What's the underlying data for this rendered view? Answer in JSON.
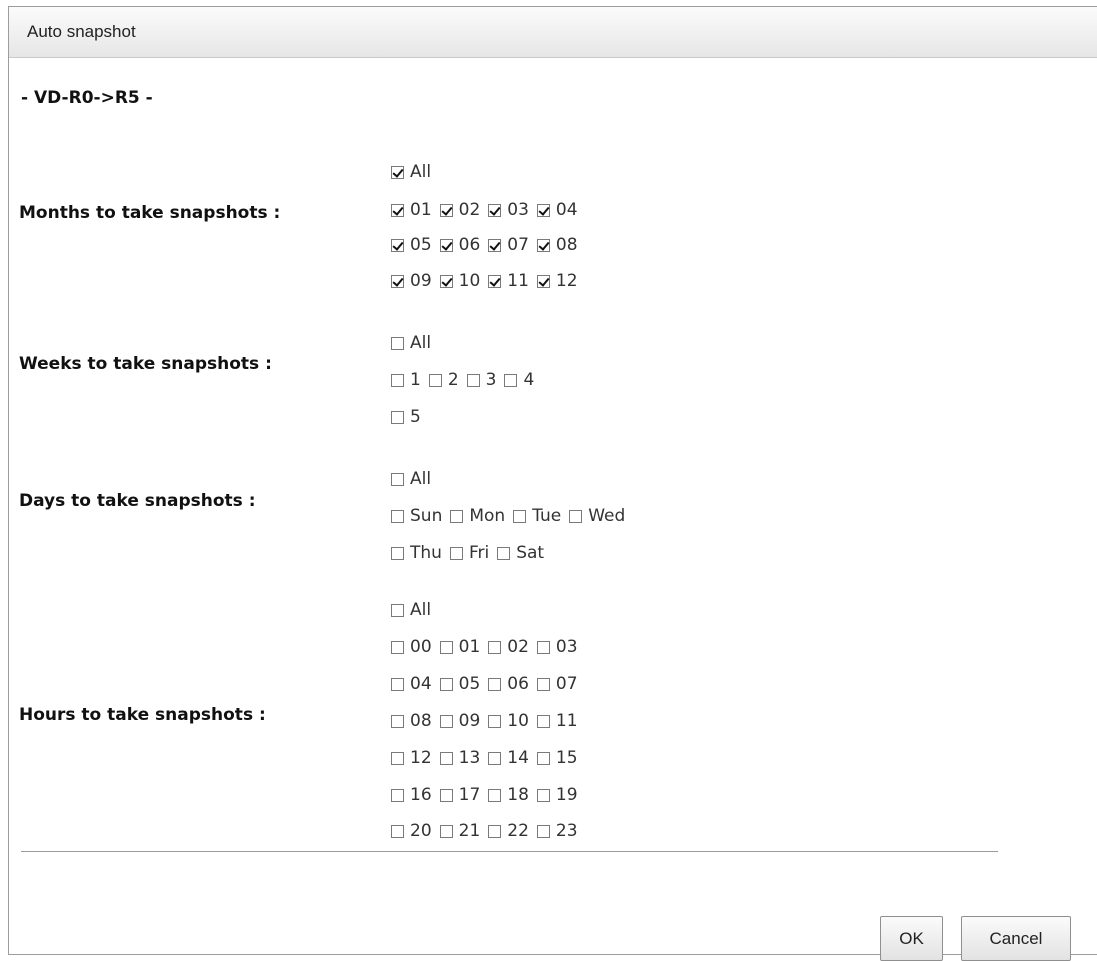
{
  "dialog": {
    "title": "Auto snapshot"
  },
  "vd_name": "- VD-R0->R5 -",
  "months": {
    "label": "Months to take snapshots :",
    "all": {
      "label": "All",
      "checked": true
    },
    "rows": [
      [
        {
          "label": "01",
          "checked": true
        },
        {
          "label": "02",
          "checked": true
        },
        {
          "label": "03",
          "checked": true
        },
        {
          "label": "04",
          "checked": true
        }
      ],
      [
        {
          "label": "05",
          "checked": true
        },
        {
          "label": "06",
          "checked": true
        },
        {
          "label": "07",
          "checked": true
        },
        {
          "label": "08",
          "checked": true
        }
      ],
      [
        {
          "label": "09",
          "checked": true
        },
        {
          "label": "10",
          "checked": true
        },
        {
          "label": "11",
          "checked": true
        },
        {
          "label": "12",
          "checked": true
        }
      ]
    ]
  },
  "weeks": {
    "label": "Weeks to take snapshots :",
    "all": {
      "label": "All",
      "checked": false
    },
    "rows": [
      [
        {
          "label": "1",
          "checked": false
        },
        {
          "label": "2",
          "checked": false
        },
        {
          "label": "3",
          "checked": false
        },
        {
          "label": "4",
          "checked": false
        }
      ],
      [
        {
          "label": "5",
          "checked": false
        }
      ]
    ]
  },
  "days": {
    "label": "Days to take snapshots :",
    "all": {
      "label": "All",
      "checked": false
    },
    "rows": [
      [
        {
          "label": "Sun",
          "checked": false
        },
        {
          "label": "Mon",
          "checked": false
        },
        {
          "label": "Tue",
          "checked": false
        },
        {
          "label": "Wed",
          "checked": false
        }
      ],
      [
        {
          "label": "Thu",
          "checked": false
        },
        {
          "label": "Fri",
          "checked": false
        },
        {
          "label": "Sat",
          "checked": false
        }
      ]
    ]
  },
  "hours": {
    "label": "Hours to take snapshots :",
    "all": {
      "label": "All",
      "checked": false
    },
    "rows": [
      [
        {
          "label": "00",
          "checked": false
        },
        {
          "label": "01",
          "checked": false
        },
        {
          "label": "02",
          "checked": false
        },
        {
          "label": "03",
          "checked": false
        }
      ],
      [
        {
          "label": "04",
          "checked": false
        },
        {
          "label": "05",
          "checked": false
        },
        {
          "label": "06",
          "checked": false
        },
        {
          "label": "07",
          "checked": false
        }
      ],
      [
        {
          "label": "08",
          "checked": false
        },
        {
          "label": "09",
          "checked": false
        },
        {
          "label": "10",
          "checked": false
        },
        {
          "label": "11",
          "checked": false
        }
      ],
      [
        {
          "label": "12",
          "checked": false
        },
        {
          "label": "13",
          "checked": false
        },
        {
          "label": "14",
          "checked": false
        },
        {
          "label": "15",
          "checked": false
        }
      ],
      [
        {
          "label": "16",
          "checked": false
        },
        {
          "label": "17",
          "checked": false
        },
        {
          "label": "18",
          "checked": false
        },
        {
          "label": "19",
          "checked": false
        }
      ],
      [
        {
          "label": "20",
          "checked": false
        },
        {
          "label": "21",
          "checked": false
        },
        {
          "label": "22",
          "checked": false
        },
        {
          "label": "23",
          "checked": false
        }
      ]
    ]
  },
  "buttons": {
    "ok": "OK",
    "cancel": "Cancel"
  }
}
